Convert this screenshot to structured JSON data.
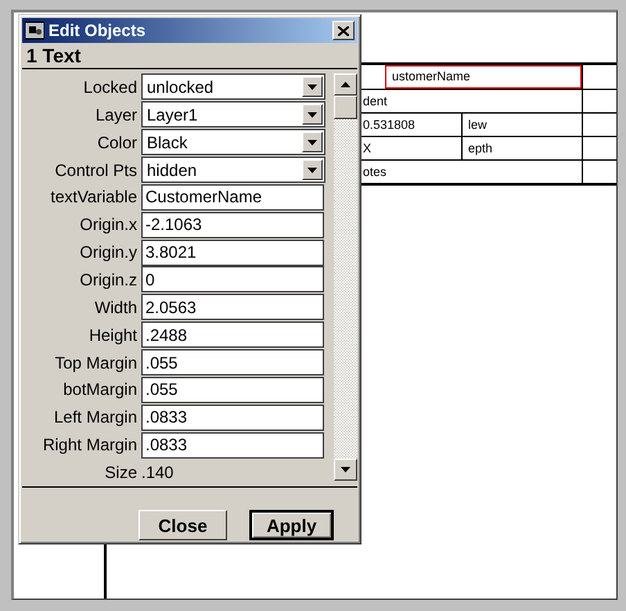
{
  "dialog": {
    "title": "Edit Objects",
    "header": "1 Text",
    "fields": [
      {
        "kind": "select",
        "label": "Locked",
        "value": "unlocked"
      },
      {
        "kind": "select",
        "label": "Layer",
        "value": "Layer1"
      },
      {
        "kind": "select",
        "label": "Color",
        "value": "Black"
      },
      {
        "kind": "select",
        "label": "Control Pts",
        "value": "hidden"
      },
      {
        "kind": "text",
        "label": "textVariable",
        "value": "CustomerName"
      },
      {
        "kind": "text",
        "label": "Origin.x",
        "value": "-2.1063"
      },
      {
        "kind": "text",
        "label": "Origin.y",
        "value": "3.8021"
      },
      {
        "kind": "text",
        "label": "Origin.z",
        "value": "0"
      },
      {
        "kind": "text",
        "label": "Width",
        "value": "2.0563"
      },
      {
        "kind": "text",
        "label": "Height",
        "value": ".2488"
      },
      {
        "kind": "text",
        "label": "Top Margin",
        "value": ".055"
      },
      {
        "kind": "text",
        "label": "botMargin",
        "value": ".055"
      },
      {
        "kind": "text",
        "label": "Left Margin",
        "value": ".0833"
      },
      {
        "kind": "text",
        "label": "Right Margin",
        "value": ".0833"
      },
      {
        "kind": "static",
        "label": "Size",
        "value": ".140"
      }
    ],
    "buttons": [
      {
        "label": "Close",
        "default": false
      },
      {
        "label": "Apply",
        "default": true
      }
    ]
  },
  "document": {
    "rows": [
      {
        "cells": [
          "ustomerName"
        ],
        "selected": true
      },
      {
        "cells": [
          "dent"
        ],
        "selected": false
      },
      {
        "cells": [
          "0.531808",
          "lew"
        ],
        "selected": false
      },
      {
        "cells": [
          "X",
          "epth"
        ],
        "selected": false
      },
      {
        "cells": [
          "otes"
        ],
        "selected": false
      }
    ]
  }
}
